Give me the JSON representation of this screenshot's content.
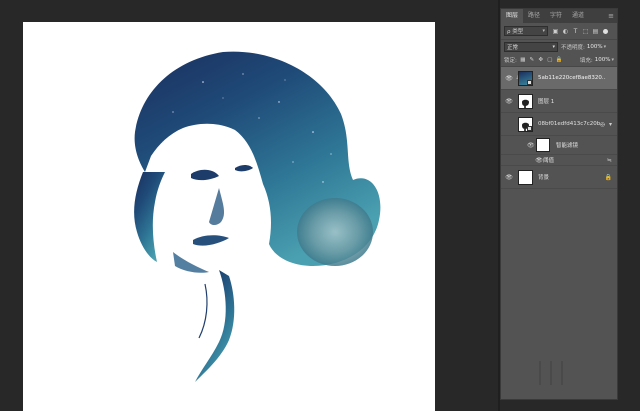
{
  "layers_panel": {
    "tabs": [
      {
        "label": "图层",
        "active": true
      },
      {
        "label": "路径",
        "active": false
      },
      {
        "label": "字符",
        "active": false
      },
      {
        "label": "通道",
        "active": false
      }
    ],
    "menu_icon": "panel-menu-icon",
    "filter": {
      "kind_label": "ρ 类型",
      "icons": [
        "image-filter-icon",
        "adjustment-filter-icon",
        "type-filter-icon",
        "shape-filter-icon",
        "smart-object-filter-icon"
      ]
    },
    "blend_mode": "正常",
    "opacity_label": "不透明度:",
    "opacity_value": "100%",
    "lock_label": "锁定:",
    "fill_label": "填充:",
    "fill_value": "100%",
    "layers": [
      {
        "name": "5ab11e220cef8ae8320...",
        "selected": true,
        "visible": true
      },
      {
        "name": "图层 1",
        "selected": false,
        "visible": true
      },
      {
        "name": "08bf01edfd413c7c20b...",
        "selected": false,
        "visible": false
      },
      {
        "name": "智能滤镜",
        "selected": false,
        "visible": true
      },
      {
        "name": "阈值",
        "selected": false,
        "visible": true
      },
      {
        "name": "背景",
        "selected": false,
        "visible": true
      }
    ]
  },
  "colors": {
    "workspace": "#282828",
    "panel": "#535353",
    "selected_layer": "#6a6a6a",
    "galaxy_dark": "#1c3a66",
    "galaxy_teal": "#3b8aa0"
  }
}
